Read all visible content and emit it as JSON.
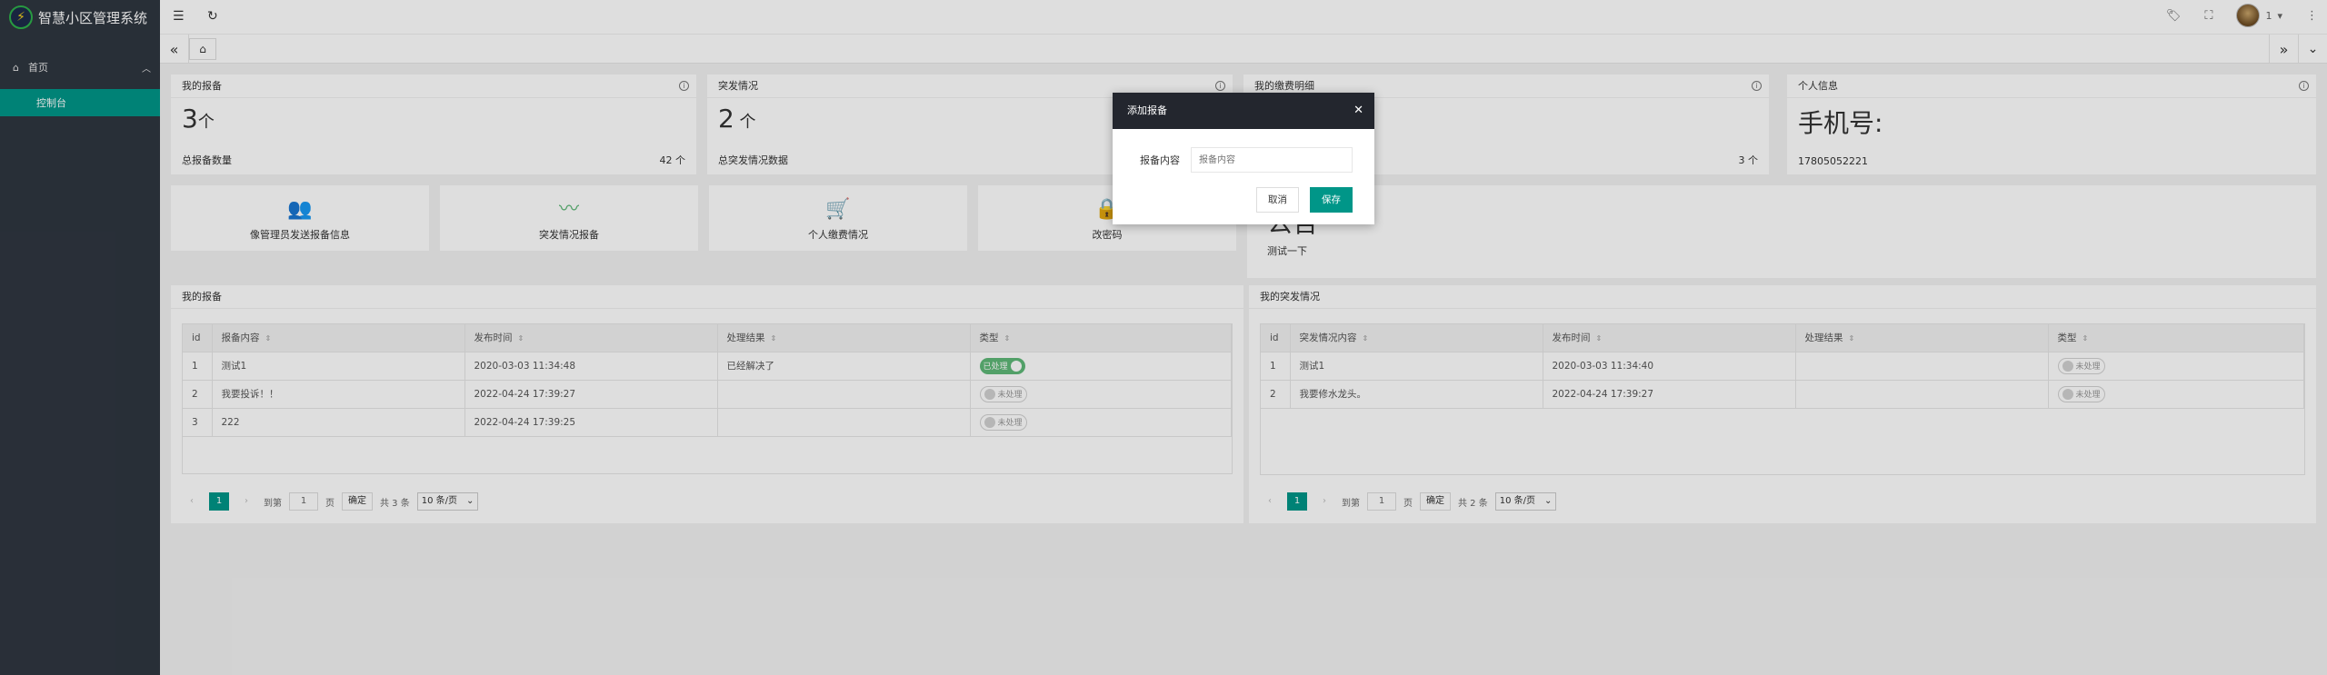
{
  "app": {
    "title": "智慧小区管理系统"
  },
  "sidebar": {
    "menu": [
      {
        "label": "首页"
      }
    ],
    "sub": [
      {
        "label": "控制台"
      }
    ]
  },
  "header": {
    "user": "1"
  },
  "stats": [
    {
      "title": "我的报备",
      "value": "3",
      "unit": "个",
      "foot_label": "总报备数量",
      "foot_value": "42 个"
    },
    {
      "title": "突发情况",
      "value": "2",
      "unit": " 个",
      "foot_label": "总突发情况数据",
      "foot_value": ""
    },
    {
      "title": "我的缴费明细",
      "value": "",
      "unit": "",
      "foot_label": "",
      "foot_value": "3 个"
    },
    {
      "title": "个人信息",
      "value": "手机号:",
      "unit": "",
      "foot_label": "17805052221",
      "foot_value": ""
    }
  ],
  "quick": [
    {
      "label": "像管理员发送报备信息",
      "icon": "users-icon"
    },
    {
      "label": "突发情况报备",
      "icon": "pulse-icon"
    },
    {
      "label": "个人缴费情况",
      "icon": "cart-icon"
    },
    {
      "label": "改密码",
      "icon": "lock-icon"
    }
  ],
  "notice": {
    "title": "公告",
    "text": "测试一下"
  },
  "report_table": {
    "title": "我的报备",
    "headers": [
      "id",
      "报备内容",
      "发布时间",
      "处理结果",
      "类型"
    ],
    "rows": [
      {
        "id": "1",
        "content": "测试1",
        "time": "2020-03-03 11:34:48",
        "result": "已经解决了",
        "status": "已处理",
        "on": true
      },
      {
        "id": "2",
        "content": "我要投诉！！",
        "time": "2022-04-24 17:39:27",
        "result": "",
        "status": "未处理",
        "on": false
      },
      {
        "id": "3",
        "content": "222",
        "time": "2022-04-24 17:39:25",
        "result": "",
        "status": "未处理",
        "on": false
      }
    ],
    "pager": {
      "page": "1",
      "goto": "到第",
      "page_unit": "页",
      "ok": "确定",
      "total": "共 3 条",
      "size": "10 条/页"
    }
  },
  "emergency_table": {
    "title": "我的突发情况",
    "headers": [
      "id",
      "突发情况内容",
      "发布时间",
      "处理结果",
      "类型"
    ],
    "rows": [
      {
        "id": "1",
        "content": "测试1",
        "time": "2020-03-03 11:34:40",
        "result": "",
        "status": "未处理",
        "on": false
      },
      {
        "id": "2",
        "content": "我要修水龙头。",
        "time": "2022-04-24 17:39:27",
        "result": "",
        "status": "未处理",
        "on": false
      }
    ],
    "pager": {
      "page": "1",
      "goto": "到第",
      "page_unit": "页",
      "ok": "确定",
      "total": "共 2 条",
      "size": "10 条/页"
    }
  },
  "dialog": {
    "title": "添加报备",
    "field_label": "报备内容",
    "placeholder": "报备内容",
    "cancel": "取消",
    "save": "保存"
  }
}
